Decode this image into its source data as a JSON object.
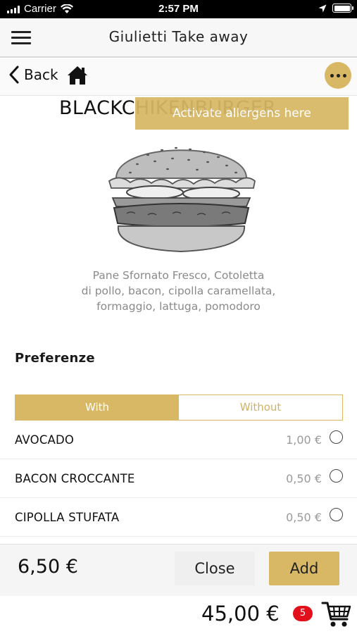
{
  "status_bar": {
    "carrier": "Carrier",
    "time": "2:57 PM",
    "icons": [
      "wifi-icon",
      "location-icon",
      "battery-icon"
    ]
  },
  "header": {
    "title": "Giulietti Take away",
    "menu_icon": "hamburger-menu-icon"
  },
  "nav": {
    "back_label": "Back",
    "home_icon": "home-icon",
    "more_icon": "more-options-icon"
  },
  "product": {
    "title": "BLACKCHIKENBURGER",
    "allergen_tip": "Activate allergens here",
    "description": [
      "Pane Sfornato Fresco, Cotoletta",
      "di pollo, bacon, cipolla caramellata,",
      "formaggio, lattuga, pomodoro"
    ]
  },
  "preferences": {
    "title": "Preferenze",
    "with_label": "With",
    "without_label": "Without",
    "options": [
      {
        "name": "AVOCADO",
        "price": "1,00 €"
      },
      {
        "name": "BACON CROCCANTE",
        "price": "0,50 €"
      },
      {
        "name": "CIPOLLA STUFATA",
        "price": "0,50 €"
      }
    ]
  },
  "footer": {
    "price": "6,50 €",
    "close_label": "Close",
    "add_label": "Add"
  },
  "cart": {
    "total": "45,00 €",
    "count": "5",
    "icon": "shopping-cart-icon"
  },
  "colors": {
    "accent": "#d8b865",
    "badge": "#e2101a",
    "muted": "#9a9a9a"
  }
}
